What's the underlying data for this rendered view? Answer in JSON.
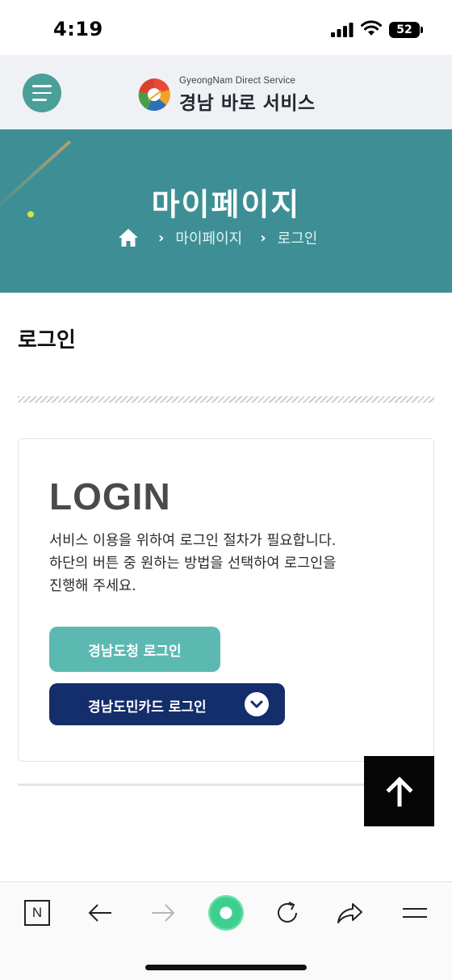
{
  "status_bar": {
    "time": "4:19",
    "battery": "52"
  },
  "header": {
    "logo_sub": "GyeongNam Direct Service",
    "logo_main": "경남 바로 서비스",
    "menu_icon": "hamburger-icon"
  },
  "banner": {
    "title": "마이페이지",
    "breadcrumb": [
      "마이페이지",
      "로그인"
    ],
    "home_icon": "home-icon"
  },
  "section": {
    "title": "로그인"
  },
  "login": {
    "heading": "LOGIN",
    "description_lines": [
      "서비스 이용을 위하여 로그인 절차가 필요합니다.",
      "하단의 버튼 중 원하는 방법을 선택하여 로그인을",
      "진행해 주세요."
    ],
    "gov_button": "경남도청 로그인",
    "card_button": "경남도민카드 로그인"
  },
  "scroll_top_icon": "arrow-up-icon",
  "toolbar": {
    "tab_label": "N",
    "icons": [
      "n-tab-icon",
      "back-arrow-icon",
      "forward-arrow-icon",
      "green-dot-icon",
      "reload-icon",
      "share-icon",
      "menu-icon"
    ]
  },
  "colors": {
    "teal_banner": "#3d8f95",
    "teal_button": "#5cb9b2",
    "navy_button": "#142d6b",
    "menu_button": "#4a9f98"
  }
}
